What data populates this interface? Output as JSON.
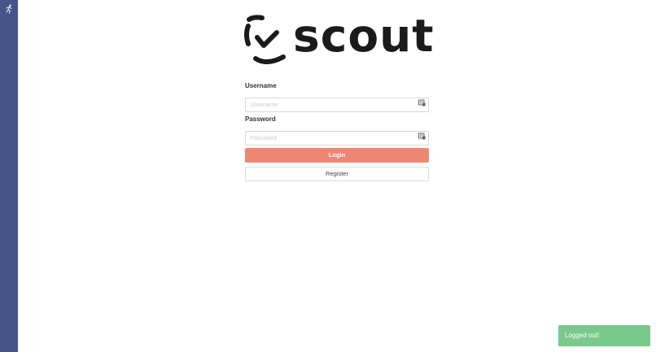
{
  "sidebar": {
    "icon": "runner-icon"
  },
  "logo": {
    "text": "scout",
    "icon": "check-mark-icon"
  },
  "form": {
    "username": {
      "label": "Username",
      "placeholder": "Username",
      "value": "",
      "icon": "id-card-icon"
    },
    "password": {
      "label": "Password",
      "placeholder": "Password",
      "value": "",
      "icon": "id-card-icon"
    },
    "login_label": "Login",
    "register_label": "Register"
  },
  "toast": {
    "message": "Logged out!"
  },
  "colors": {
    "sidebar": "#45558a",
    "login_button": "#ee8675",
    "toast": "#79c98c"
  }
}
